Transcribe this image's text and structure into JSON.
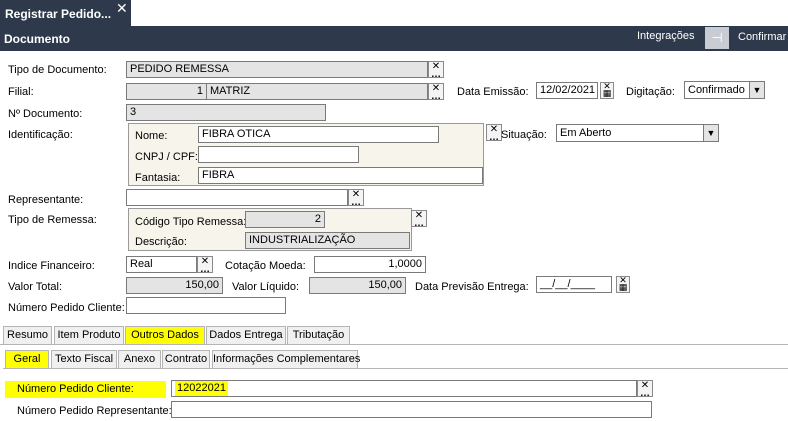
{
  "tab": {
    "title": "Registrar Pedido...",
    "close": "✕"
  },
  "header": {
    "title": "Documento",
    "integrations": "Integrações",
    "pin": "⊣",
    "confirm": "Confirmar"
  },
  "form": {
    "tipo_documento": {
      "label": "Tipo de Documento:",
      "value": "PEDIDO REMESSA"
    },
    "filial": {
      "label": "Filial:",
      "code": "1",
      "name": "MATRIZ"
    },
    "data_emissao": {
      "label": "Data Emissão:",
      "value": "12/02/2021"
    },
    "digitacao": {
      "label": "Digitação:",
      "value": "Confirmado"
    },
    "numero_documento": {
      "label": "Nº Documento:",
      "value": "3"
    },
    "identificacao": {
      "label": "Identificação:",
      "nome_label": "Nome:",
      "nome": "FIBRA OTICA",
      "cnpj_label": "CNPJ / CPF:",
      "cnpj": "",
      "fantasia_label": "Fantasia:",
      "fantasia": "FIBRA"
    },
    "situacao": {
      "label": "Situação:",
      "value": "Em Aberto"
    },
    "representante": {
      "label": "Representante:",
      "value": ""
    },
    "tipo_remessa": {
      "label": "Tipo de Remessa:",
      "codigo_label": "Código Tipo Remessa:",
      "codigo": "2",
      "descricao_label": "Descrição:",
      "descricao": "INDUSTRIALIZAÇÃO"
    },
    "indice_financeiro": {
      "label": "Indice Financeiro:",
      "value": "Real"
    },
    "cotacao_moeda": {
      "label": "Cotação Moeda:",
      "value": "1,0000"
    },
    "valor_total": {
      "label": "Valor Total:",
      "value": "150,00"
    },
    "valor_liquido": {
      "label": "Valor Líquido:",
      "value": "150,00"
    },
    "data_previsao": {
      "label": "Data Previsão Entrega:",
      "value": "__/__/____"
    },
    "numero_pedido_cliente": {
      "label": "Número Pedido Cliente:",
      "value": ""
    }
  },
  "main_tabs": [
    "Resumo",
    "Item Produto",
    "Outros Dados",
    "Dados Entrega",
    "Tributação"
  ],
  "sub_tabs": [
    "Geral",
    "Texto Fiscal",
    "Anexo",
    "Contrato",
    "Informações Complementares"
  ],
  "geral": {
    "pedido_cliente_label": "Número Pedido Cliente:",
    "pedido_cliente_value": "12022021",
    "pedido_representante_label": "Número Pedido Representante:",
    "pedido_representante_value": ""
  },
  "icons": {
    "lookup": "✕ …",
    "calendar": "calendar-icon",
    "dropdown": "▼"
  },
  "colors": {
    "header": "#2e3a4c",
    "highlight": "#ffff00",
    "readonly": "#e4e4e4"
  }
}
